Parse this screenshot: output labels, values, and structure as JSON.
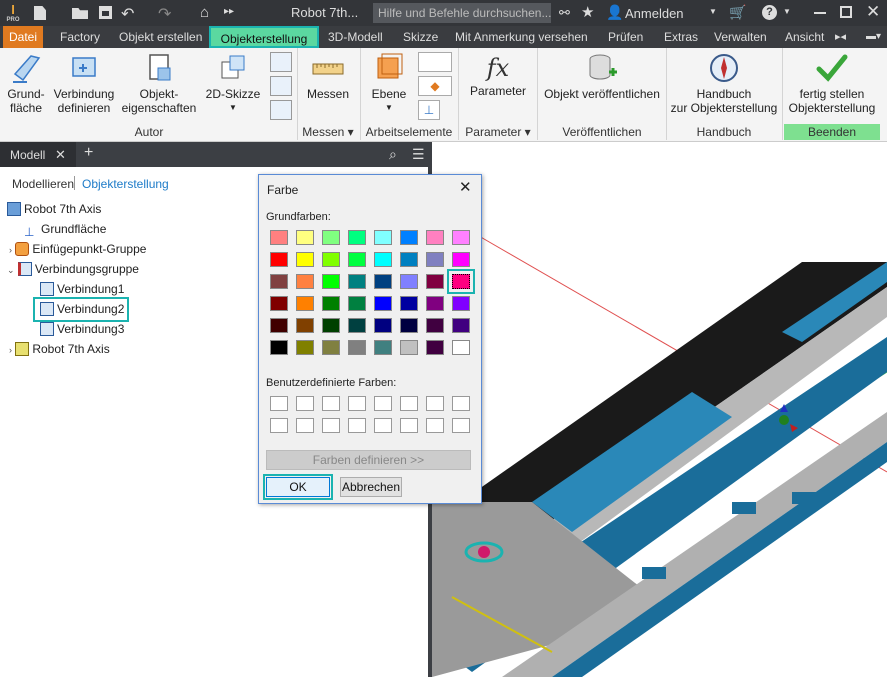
{
  "titlebar": {
    "title": "Robot 7th...",
    "search_placeholder": "Hilfe und Befehle durchsuchen...",
    "signin": "Anmelden",
    "app_badge": "PRO"
  },
  "ribbon_tabs": [
    "Datei",
    "Factory",
    "Objekt erstellen",
    "Objekterstellung",
    "3D-Modell",
    "Skizze",
    "Mit Anmerkung versehen",
    "Prüfen",
    "Extras",
    "Verwalten",
    "Ansicht"
  ],
  "ribbon": {
    "grundflaeche": "Grund-\nfläche",
    "verbindung": "Verbindung\ndefinieren",
    "objekt_eig": "Objekt-\neigenschaften",
    "skizze2d": "2D-Skizze",
    "messen": "Messen",
    "ebene": "Ebene",
    "parameter": "Parameter",
    "veroeffentlichen": "Objekt veröffentlichen",
    "handbuch": "Handbuch\nzur Objekterstellung",
    "fertig": "fertig stellen\nObjekterstellung",
    "groups": {
      "autor": "Autor",
      "messen": "Messen",
      "arbeitselemente": "Arbeitselemente",
      "parameter": "Parameter",
      "veroeffentlichen": "Veröffentlichen",
      "handbuch": "Handbuch",
      "beenden": "Beenden"
    }
  },
  "panel": {
    "tab": "Modell",
    "subtabs": {
      "left": "Modellieren",
      "right": "Objekterstellung"
    },
    "tree": [
      "Robot 7th Axis",
      "Grundfläche",
      "Einfügepunkt-Gruppe",
      "Verbindungsgruppe",
      "Verbindung1",
      "Verbindung2",
      "Verbindung3",
      "Robot 7th Axis"
    ]
  },
  "dialog": {
    "title": "Farbe",
    "basic_label": "Grundfarben:",
    "custom_label": "Benutzerdefinierte Farben:",
    "define_button": "Farben definieren >>",
    "ok": "OK",
    "cancel": "Abbrechen",
    "basic_colors": [
      [
        "#ff8080",
        "#ffff80",
        "#80ff80",
        "#00ff80",
        "#80ffff",
        "#0080ff",
        "#ff80c0",
        "#ff80ff"
      ],
      [
        "#ff0000",
        "#ffff00",
        "#80ff00",
        "#00ff40",
        "#00ffff",
        "#0080c0",
        "#8080c0",
        "#ff00ff"
      ],
      [
        "#804040",
        "#ff8040",
        "#00ff00",
        "#008080",
        "#004080",
        "#8080ff",
        "#800040",
        "#ff0080"
      ],
      [
        "#800000",
        "#ff8000",
        "#008000",
        "#008040",
        "#0000ff",
        "#0000a0",
        "#800080",
        "#8000ff"
      ],
      [
        "#400000",
        "#804000",
        "#004000",
        "#004040",
        "#000080",
        "#000040",
        "#400040",
        "#400080"
      ],
      [
        "#000000",
        "#808000",
        "#808040",
        "#808080",
        "#408080",
        "#c0c0c0",
        "#400040",
        "#ffffff"
      ]
    ],
    "selected_index": [
      2,
      7
    ]
  }
}
